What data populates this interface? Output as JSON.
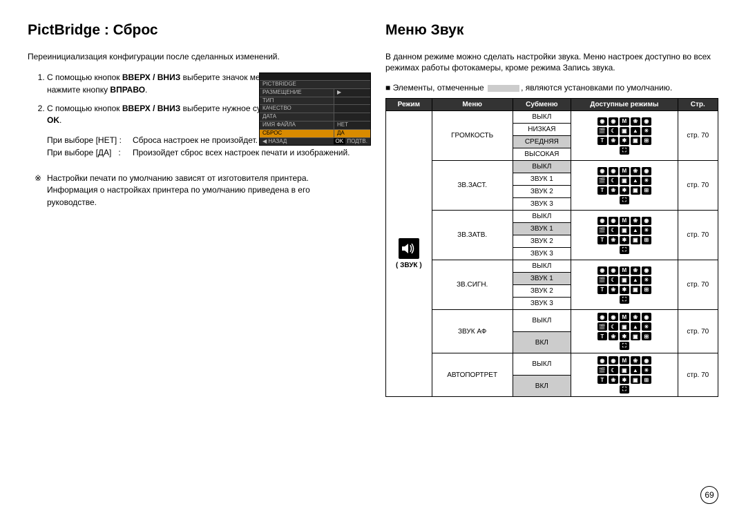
{
  "left": {
    "heading": "PictBridge : Сброс",
    "intro": "Переинициализация конфигурации после сделанных изменений.",
    "step1_a": "С помощью кнопок ",
    "step1_bold1": "ВВЕРХ / ВНИЗ",
    "step1_b": " выберите значок меню [СБРОС]. Затем нажмите кнопку ",
    "step1_bold2": "ВПРАВО",
    "step2_a": "С помощью кнопок ",
    "step2_bold1": "ВВЕРХ / ВНИЗ",
    "step2_b": " выберите нужное субменю и нажмите кнопку ",
    "step2_bold2": "OK",
    "choice_no_k": "При выборе [НЕТ] :",
    "choice_no_v": "Сброса настроек не произойдет.",
    "choice_yes_k": "При выборе [ДА]",
    "choice_yes_sep": ":",
    "choice_yes_v": "Произойдет сброс всех настроек печати и изображений.",
    "note": "Настройки печати по умолчанию зависят от изготовителя принтера. Информация о настройках принтера по умолчанию приведена в его руководстве."
  },
  "lcd": {
    "r1": "PICTBRIDGE",
    "r2": "РАЗМЕЩЕНИЕ",
    "r3": "ТИП",
    "r4": "КАЧЕСТВО",
    "r5": "ДАТА",
    "r6": "ИМЯ ФАЙЛА",
    "r6r": "НЕТ",
    "r7": "СБРОС",
    "r7r": "ДА",
    "back": "◀  НАЗАД",
    "ok": "OK",
    "confirm": "ПОДТВ."
  },
  "right": {
    "heading": "Меню Звук",
    "intro": "В данном режиме можно сделать настройки звука. Меню настроек доступно во всех режимах работы фотокамеры, кроме режима Запись звука.",
    "note_a": "■  Элементы, отмеченные ",
    "note_b": ", являются установками по умолчанию.",
    "mode_label": "( ЗВУК )",
    "th_mode": "Режим",
    "th_menu": "Меню",
    "th_sub": "Субменю",
    "th_modes": "Доступные режимы",
    "th_page": "Стр.",
    "menus": {
      "volume": "ГРОМКОСТЬ",
      "start": "ЗВ.ЗАСТ.",
      "shutter": "ЗВ.ЗАТВ.",
      "beep": "ЗВ.СИГН.",
      "af": "ЗВУК АФ",
      "self": "АВТОПОРТРЕТ"
    },
    "opts": {
      "off": "ВЫКЛ",
      "low": "НИЗКАЯ",
      "med": "СРЕДНЯЯ",
      "high": "ВЫСОКАЯ",
      "s1": "ЗВУК 1",
      "s2": "ЗВУК 2",
      "s3": "ЗВУК 3",
      "on": "ВКЛ"
    },
    "page_ref": "стр. 70"
  },
  "page_number": "69"
}
